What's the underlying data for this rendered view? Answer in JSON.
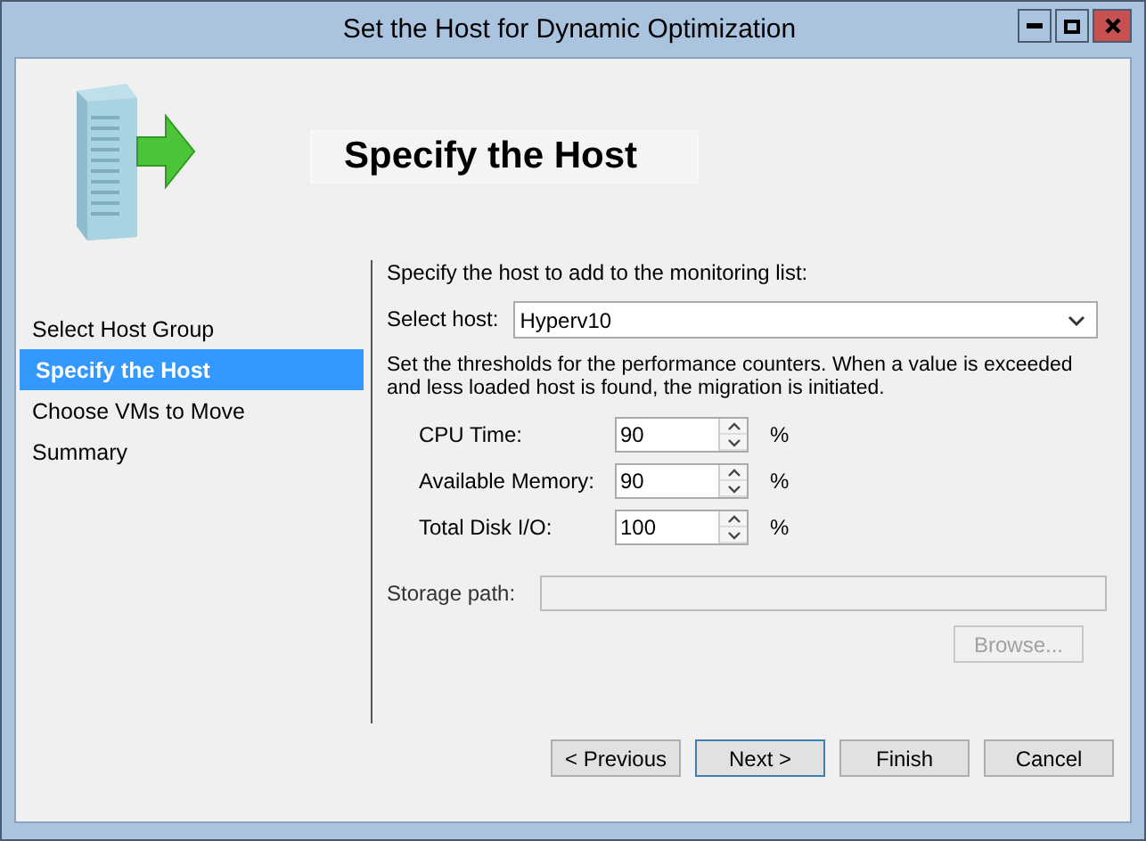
{
  "window": {
    "title": "Set the Host for Dynamic Optimization"
  },
  "header": {
    "title": "Specify the Host"
  },
  "steps": [
    {
      "label": "Select Host Group",
      "selected": false
    },
    {
      "label": "Specify the Host",
      "selected": true
    },
    {
      "label": "Choose VMs to Move",
      "selected": false
    },
    {
      "label": "Summary",
      "selected": false
    }
  ],
  "intro": "Specify the host to add to the monitoring list:",
  "host": {
    "label": "Select host:",
    "value": "Hyperv10"
  },
  "thresholds_text": "Set the thresholds for the performance counters. When a value is exceeded and less loaded host is found, the migration is initiated.",
  "counters": [
    {
      "label": "CPU Time:",
      "value": "90",
      "unit": "%"
    },
    {
      "label": "Available Memory:",
      "value": "90",
      "unit": "%"
    },
    {
      "label": "Total Disk I/O:",
      "value": "100",
      "unit": "%"
    }
  ],
  "storage": {
    "label": "Storage path:",
    "disabled": true
  },
  "browse": {
    "label": "Browse...",
    "disabled": true
  },
  "buttons": [
    {
      "label": "< Previous",
      "focused": false
    },
    {
      "label": "Next >",
      "focused": true
    },
    {
      "label": "Finish",
      "focused": false
    },
    {
      "label": "Cancel",
      "focused": false
    }
  ]
}
